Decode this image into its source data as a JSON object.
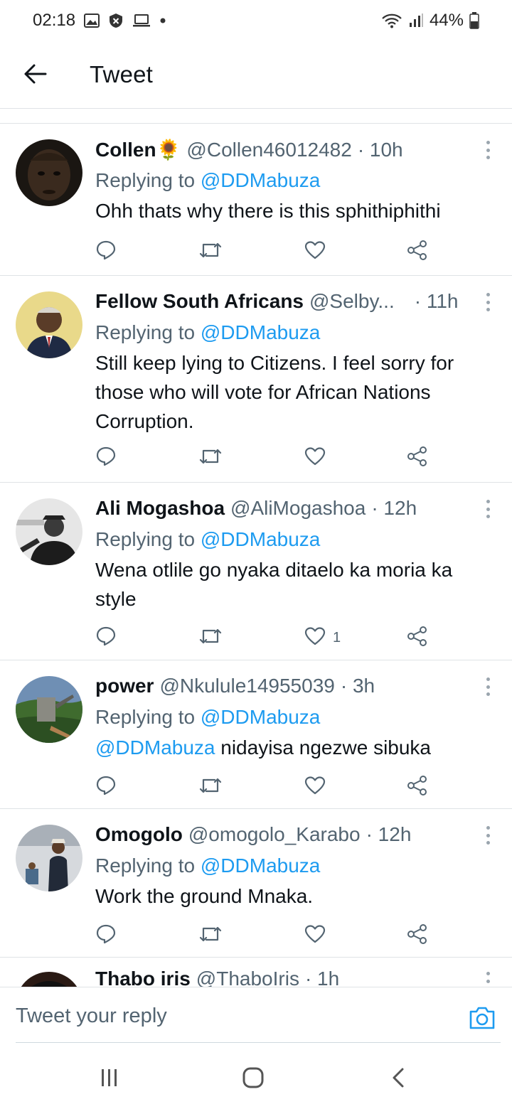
{
  "status_bar": {
    "time": "02:18",
    "battery": "44%"
  },
  "header": {
    "title": "Tweet"
  },
  "tweets": [
    {
      "name": "Collen🌻",
      "handle": "@Collen46012482",
      "time": "· 10h",
      "replying_prefix": "Replying to ",
      "replying_to": "@DDMabuza",
      "text": "Ohh thats why there is this sphithiphithi"
    },
    {
      "name": "Fellow South Africans",
      "handle": "@Selby...",
      "time": "· 11h",
      "replying_prefix": "Replying to ",
      "replying_to": "@DDMabuza",
      "text": "Still keep lying to Citizens. I feel sorry for those who will vote for African Nations Corruption."
    },
    {
      "name": "Ali Mogashoa",
      "handle": "@AliMogashoa",
      "time": "· 12h",
      "replying_prefix": "Replying to ",
      "replying_to": "@DDMabuza",
      "text": "Wena otlile go nyaka ditaelo ka moria ka style",
      "like_count": "1"
    },
    {
      "name": "power",
      "handle": "@Nkulule14955039",
      "time": "· 3h",
      "replying_prefix": "Replying to ",
      "replying_to": "@DDMabuza",
      "text_mention": "@DDMabuza",
      "text": " nidayisa ngezwe sibuka"
    },
    {
      "name": "Omogolo",
      "handle": "@omogolo_Karabo",
      "time": "· 12h",
      "replying_prefix": "Replying to ",
      "replying_to": "@DDMabuza",
      "text": "Work the ground Mnaka."
    },
    {
      "name": "Thabo iris",
      "handle": "@ThaboIris",
      "time": "· 1h"
    }
  ],
  "reply_box": {
    "placeholder": "Tweet your reply"
  },
  "colors": {
    "accent": "#1d9bf0",
    "secondary_text": "#536471",
    "primary_text": "#0f1419",
    "divider": "#dfe3e6"
  },
  "icons": {
    "back": "arrow-left-icon",
    "more": "more-vertical-icon",
    "reply": "reply-bubble-icon",
    "retweet": "retweet-icon",
    "like": "heart-icon",
    "share": "share-icon",
    "camera": "camera-icon",
    "nav_recents": "recents-icon",
    "nav_home": "home-icon",
    "nav_back": "nav-back-icon"
  }
}
